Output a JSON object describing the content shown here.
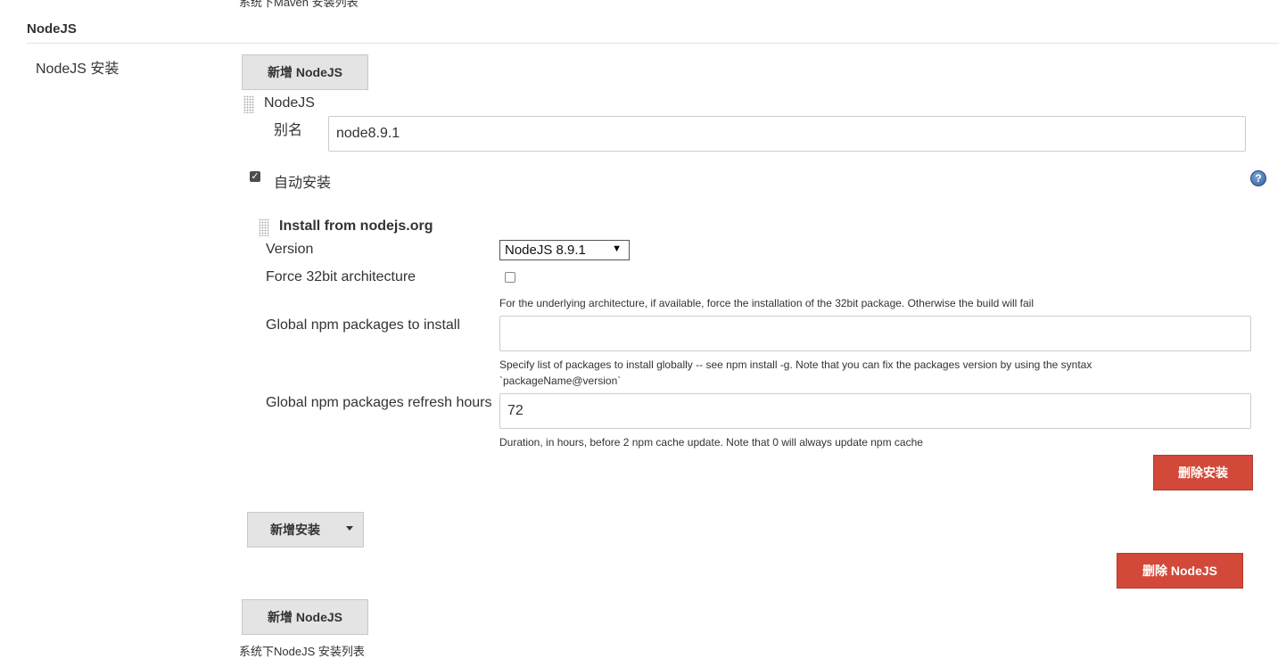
{
  "top_cutoff_text": "系统下Maven 安装列表",
  "section": {
    "title": "NodeJS"
  },
  "nodejs_install": {
    "label": "NodeJS 安装",
    "add_button_label": "新增 NodeJS",
    "entry": {
      "header": "NodeJS",
      "alias_label": "别名",
      "alias_value": "node8.9.1",
      "auto_install_label": "自动安装",
      "auto_install_checked": true,
      "help_icon": "question-mark",
      "installer": {
        "title": "Install from nodejs.org",
        "version_label": "Version",
        "version_selected": "NodeJS 8.9.1",
        "force32_label": "Force 32bit architecture",
        "force32_checked": false,
        "force32_help": "For the underlying architecture, if available, force the installation of the 32bit package. Otherwise the build will fail",
        "npm_packages_label": "Global npm packages to install",
        "npm_packages_value": "",
        "npm_packages_help": "Specify list of packages to install globally -- see npm install -g. Note that you can fix the packages version by using the syntax `packageName@version`",
        "refresh_hours_label": "Global npm packages refresh hours",
        "refresh_hours_value": "72",
        "refresh_hours_help": "Duration, in hours, before 2 npm cache update. Note that 0 will always update npm cache",
        "delete_installer_label": "删除安装"
      },
      "add_installer_label": "新增安装",
      "delete_nodejs_label": "删除 NodeJS"
    },
    "add_button_bottom_label": "新增 NodeJS",
    "footer_text": "系统下NodeJS 安装列表"
  },
  "colors": {
    "danger": "#d24939",
    "button_gray": "#e4e4e4",
    "text": "#333333"
  }
}
